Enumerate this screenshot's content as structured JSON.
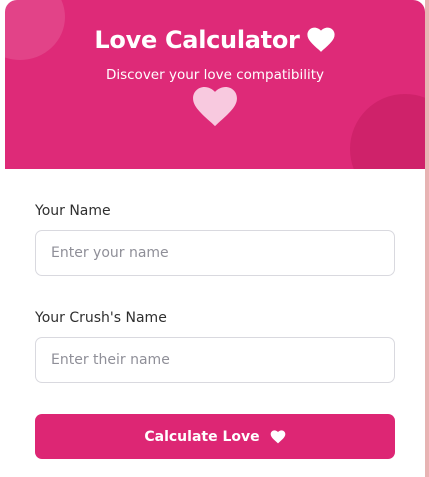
{
  "header": {
    "title": "Love Calculator",
    "subtitle": "Discover your love compatibility",
    "title_icon": "heart-icon",
    "decor_icon": "heart-icon"
  },
  "form": {
    "your_name": {
      "label": "Your Name",
      "placeholder": "Enter your name",
      "value": ""
    },
    "crush_name": {
      "label": "Your Crush's Name",
      "placeholder": "Enter their name",
      "value": ""
    },
    "submit": {
      "label": "Calculate Love",
      "icon": "heart-icon"
    }
  },
  "colors": {
    "brand_pink": "#de2a78",
    "button_pink": "#dd2674",
    "light_heart": "#f8c9df",
    "text_dark": "#2f2f2f",
    "placeholder": "#8f8f98",
    "field_border": "#d9d9df"
  }
}
